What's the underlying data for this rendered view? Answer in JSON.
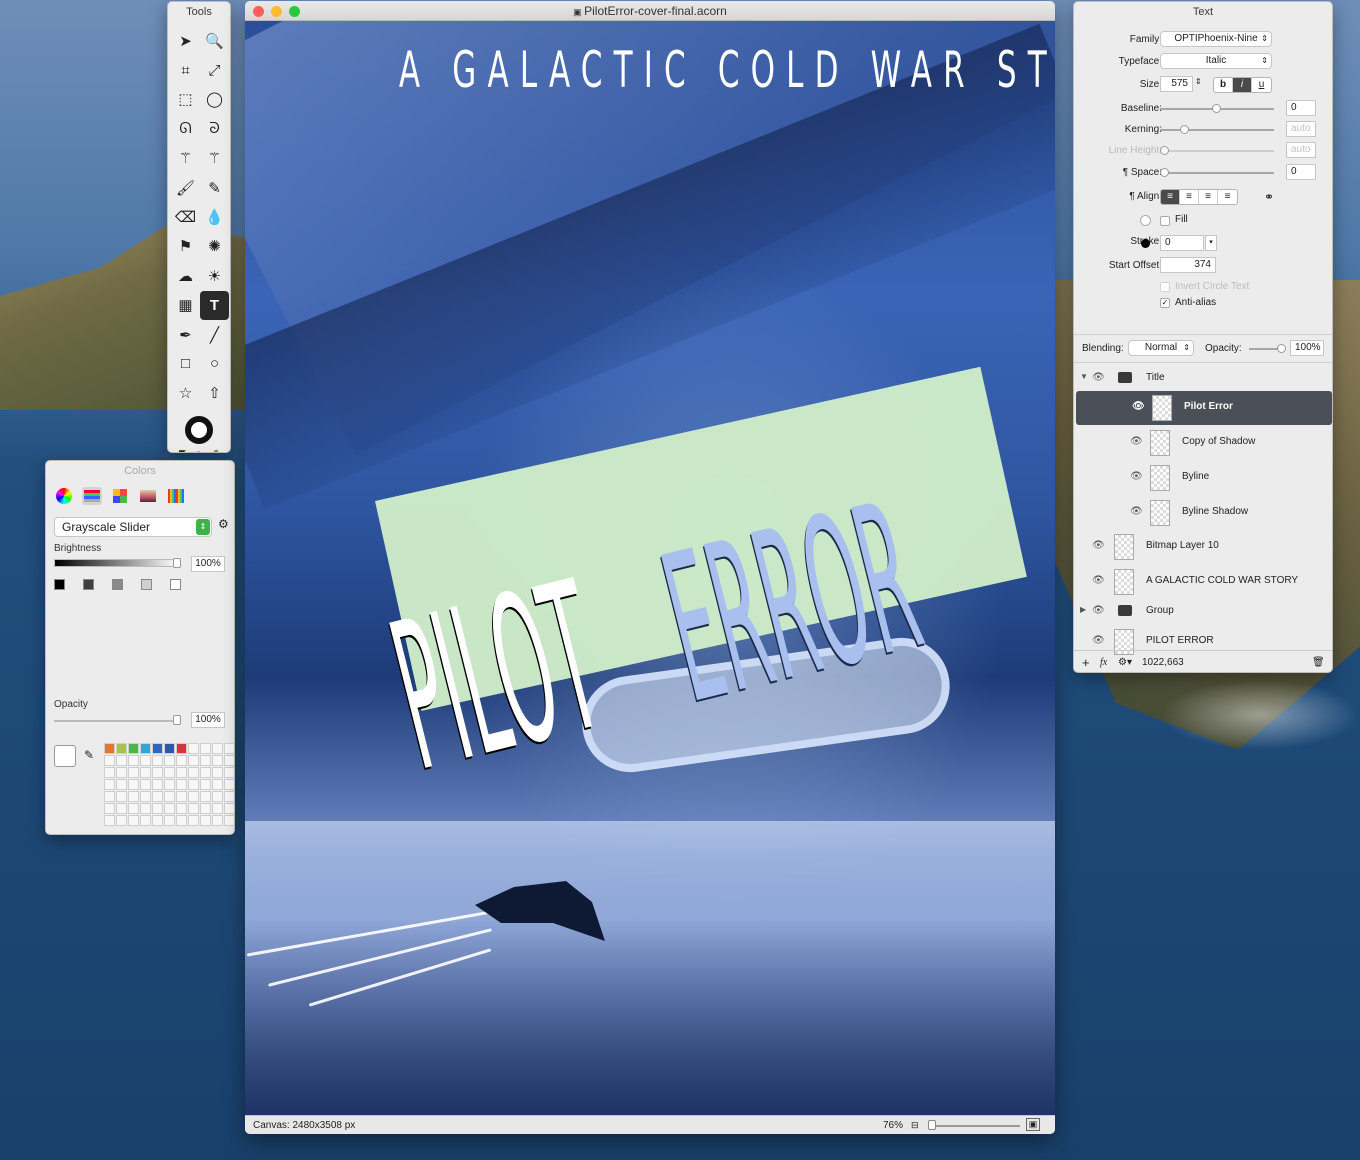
{
  "tools_panel": {
    "title": "Tools",
    "tools": [
      "arrow-icon",
      "zoom-icon",
      "crop-icon",
      "resize-icon",
      "rect-select-icon",
      "ellipse-select-icon",
      "lasso-icon",
      "poly-lasso-icon",
      "magic-wand-icon",
      "magic-wand-alt-icon",
      "brush-icon",
      "pencil-icon",
      "eraser-icon",
      "smudge-icon",
      "stamp-icon",
      "effects-icon",
      "cloud-icon",
      "sun-icon",
      "gradient-icon",
      "text-tool-icon",
      "pen-icon",
      "line-icon",
      "rectangle-icon",
      "circle-icon",
      "star-icon",
      "arrow-shape-icon"
    ],
    "tool_glyphs": [
      "➤",
      "🔍",
      "⌗",
      "⤢",
      "⬚",
      "◯",
      "ᘏ",
      "ᘐ",
      "⚚",
      "⚚",
      "🖌",
      "✎",
      "⌫",
      "💧",
      "⚑",
      "✺",
      "☁",
      "☀",
      "▦",
      "T",
      "✒",
      "╱",
      "□",
      "○",
      "☆",
      "⇧"
    ],
    "active_tool": "text-tool-icon"
  },
  "colors_panel": {
    "title": "Colors",
    "picker_mode": "Grayscale Slider",
    "brightness_label": "Brightness",
    "brightness_value": "100%",
    "opacity_label": "Opacity",
    "opacity_value": "100%",
    "gray_swatches": [
      "#000000",
      "#3f3f3f",
      "#8a8a8a",
      "#cfcfcf",
      "#ffffff"
    ],
    "favorite_colors": [
      "#e8742b",
      "#a7c44a",
      "#4cb548",
      "#31a7d8",
      "#3066c5",
      "#2e56b4",
      "#d8333b"
    ]
  },
  "document": {
    "filename": "PilotError-cover-final.acorn",
    "headline": "A GALACTIC COLD WAR STORY",
    "title_word1": "PILOT",
    "title_word2": "ERROR",
    "canvas_info": "Canvas: 2480x3508 px",
    "zoom": "76%",
    "accent_green": "#cdeec8",
    "title_blue": "#a9bfee"
  },
  "inspector": {
    "title": "Text",
    "family_label": "Family:",
    "family": "OPTIPhoenix-Nine",
    "typeface_label": "Typeface:",
    "typeface": "Italic",
    "size_label": "Size:",
    "size": "575",
    "bold": "b",
    "italic": "i",
    "underline": "u",
    "baseline_label": "Baseline:",
    "baseline": "0",
    "kerning_label": "Kerning:",
    "kerning": "auto",
    "line_height_label": "Line Height:",
    "line_height": "auto",
    "space_label": "¶ Space:",
    "space": "0",
    "align_label": "¶ Align:",
    "fill_label": "Fill",
    "stroke_label": "Stroke:",
    "stroke": "0",
    "start_offset_label": "Start Offset:",
    "start_offset": "374",
    "invert_circle_label": "Invert Circle Text",
    "antialias_label": "Anti-alias",
    "blending_label": "Blending:",
    "blending": "Normal",
    "opacity_label": "Opacity:",
    "opacity": "100%"
  },
  "layers": {
    "items": [
      {
        "name": "Title",
        "type": "group",
        "expanded": true
      },
      {
        "name": "Pilot Error",
        "type": "text",
        "selected": true
      },
      {
        "name": "Copy of Shadow",
        "type": "bitmap"
      },
      {
        "name": "Byline",
        "type": "bitmap"
      },
      {
        "name": "Byline Shadow",
        "type": "bitmap"
      },
      {
        "name": "Bitmap Layer 10",
        "type": "bitmap"
      },
      {
        "name": "A GALACTIC COLD WAR STORY",
        "type": "bitmap"
      },
      {
        "name": "Group",
        "type": "group",
        "expanded": false
      },
      {
        "name": "PILOT ERROR",
        "type": "bitmap"
      }
    ],
    "footer_coords": "1022,663"
  }
}
